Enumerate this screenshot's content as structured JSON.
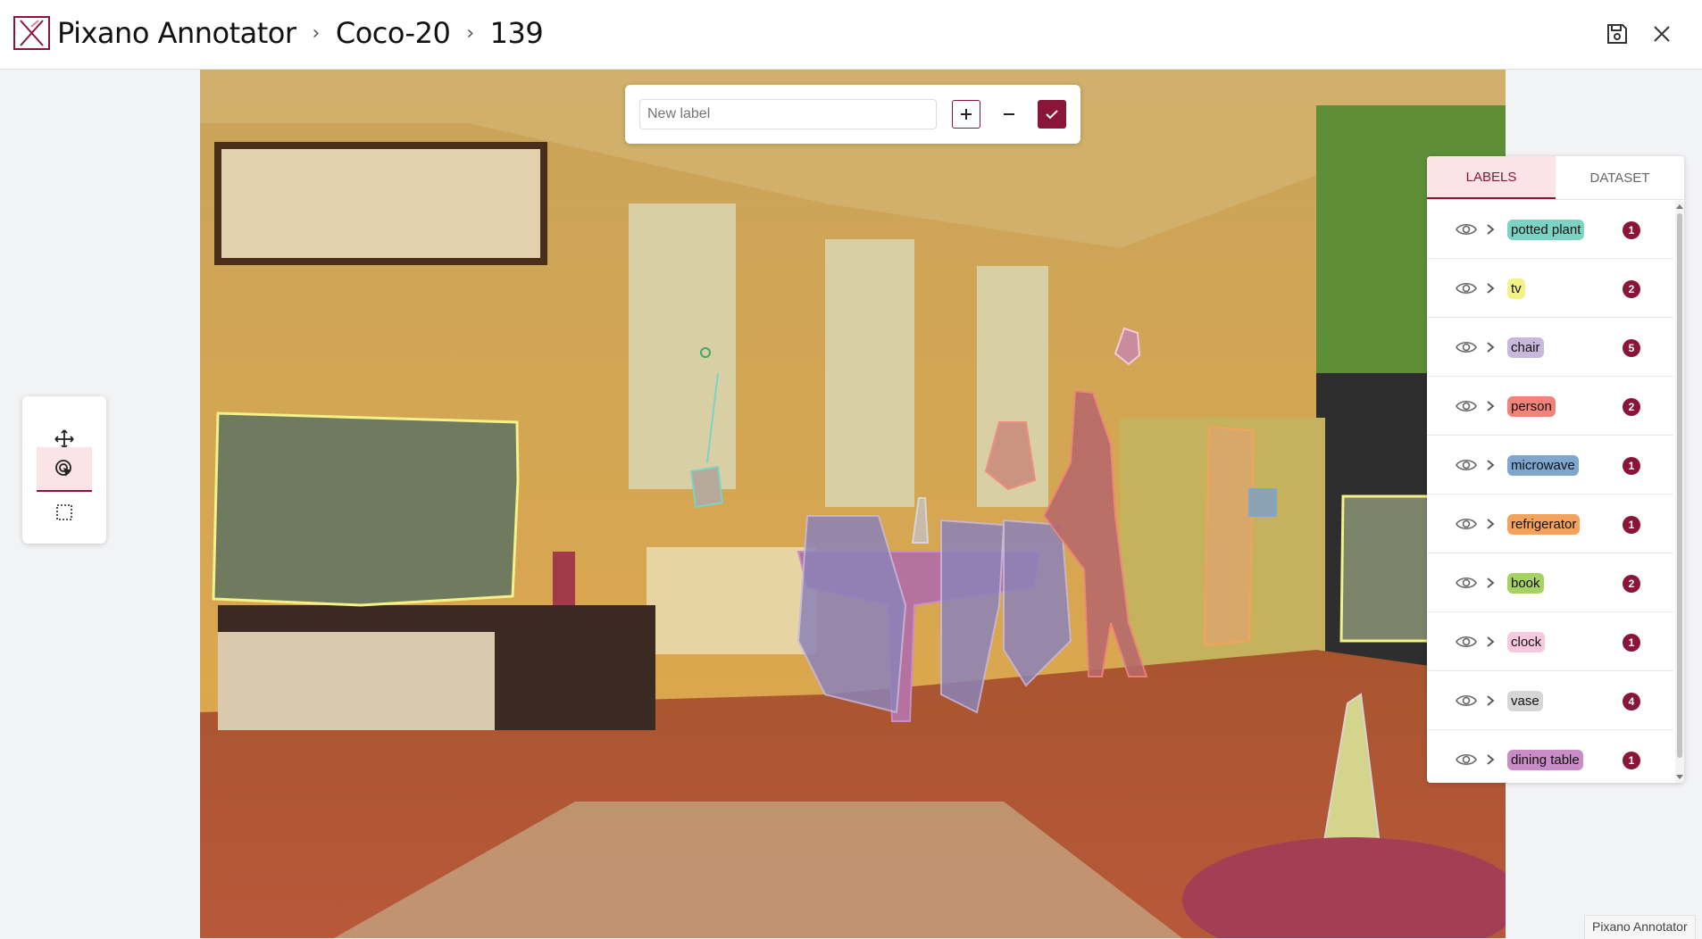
{
  "header": {
    "app_name": "Pixano Annotator",
    "dataset": "Coco-20",
    "item_id": "139",
    "separator": "›"
  },
  "toolbar": {
    "tools": [
      {
        "name": "pan-tool",
        "icon": "move-icon",
        "active": false
      },
      {
        "name": "smart-select-tool",
        "icon": "cursor-target-icon",
        "active": true
      },
      {
        "name": "rectangle-tool",
        "icon": "dashed-rectangle-icon",
        "active": false
      }
    ]
  },
  "label_input": {
    "placeholder": "New label",
    "value": ""
  },
  "panel": {
    "tabs": [
      "LABELS",
      "DATASET"
    ],
    "active_tab": "LABELS",
    "labels": [
      {
        "name": "potted plant",
        "count": "1",
        "color": "#7cd3c3"
      },
      {
        "name": "tv",
        "count": "2",
        "color": "#f3f18a"
      },
      {
        "name": "chair",
        "count": "5",
        "color": "#c7b8dc"
      },
      {
        "name": "person",
        "count": "2",
        "color": "#f2837a"
      },
      {
        "name": "microwave",
        "count": "1",
        "color": "#7ea6cf"
      },
      {
        "name": "refrigerator",
        "count": "1",
        "color": "#f3a35c"
      },
      {
        "name": "book",
        "count": "2",
        "color": "#a6d265"
      },
      {
        "name": "clock",
        "count": "1",
        "color": "#f7c9de"
      },
      {
        "name": "vase",
        "count": "4",
        "color": "#d6d6d6"
      },
      {
        "name": "dining table",
        "count": "1",
        "color": "#c98cc7"
      }
    ]
  },
  "footer": {
    "label": "Pixano Annotator"
  },
  "colors": {
    "accent": "#8a1538",
    "accent_light": "#fbe3e8"
  }
}
